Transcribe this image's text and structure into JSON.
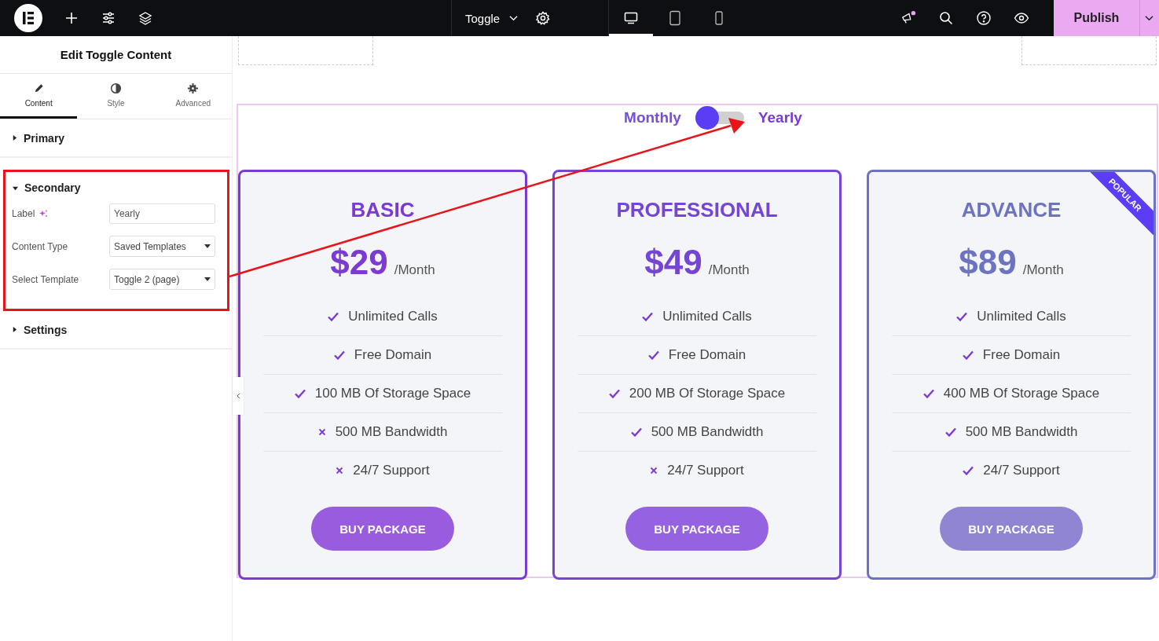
{
  "topbar": {
    "document": "Toggle",
    "devices": [
      {
        "kind": "desktop",
        "selected": true
      },
      {
        "kind": "tablet",
        "selected": false
      },
      {
        "kind": "mobile",
        "selected": false
      }
    ],
    "notification": true,
    "publish": "Publish"
  },
  "panel": {
    "title": "Edit Toggle Content",
    "tabs": [
      {
        "label": "Content",
        "kind": "pencil",
        "selected": true
      },
      {
        "label": "Style",
        "kind": "contrast",
        "selected": false
      },
      {
        "label": "Advanced",
        "kind": "gear",
        "selected": false
      }
    ],
    "sections": [
      {
        "title": "Primary",
        "expanded": false,
        "highlighted": false
      },
      {
        "title": "Secondary",
        "expanded": true,
        "highlighted": true,
        "fields": [
          {
            "label": "Label",
            "kind": "text",
            "ai": true,
            "value": "Yearly"
          },
          {
            "label": "Content Type",
            "kind": "select",
            "ai": false,
            "value": "Saved Templates"
          },
          {
            "label": "Select Template",
            "kind": "select",
            "ai": false,
            "value": "Toggle 2 (page)"
          }
        ]
      },
      {
        "title": "Settings",
        "expanded": false,
        "highlighted": false
      }
    ]
  },
  "toggle": {
    "left": "Monthly",
    "right": "Yearly",
    "on": false
  },
  "plans": [
    {
      "name": "BASIC",
      "price": "$29",
      "period": "/Month",
      "color": "#7b3bd3",
      "features": [
        {
          "text": "Unlimited Calls",
          "kind": "check"
        },
        {
          "text": "Free Domain",
          "kind": "check"
        },
        {
          "text": "100 MB Of Storage Space",
          "kind": "check"
        },
        {
          "text": "500 MB Bandwidth",
          "kind": "cross"
        },
        {
          "text": "24/7 Support",
          "kind": "cross"
        }
      ],
      "button": "BUY PACKAGE"
    },
    {
      "name": "PROFESSIONAL",
      "price": "$49",
      "period": "/Month",
      "color": "#7545d6",
      "features": [
        {
          "text": "Unlimited Calls",
          "kind": "check"
        },
        {
          "text": "Free Domain",
          "kind": "check"
        },
        {
          "text": "200 MB Of Storage Space",
          "kind": "check"
        },
        {
          "text": "500 MB Bandwidth",
          "kind": "check"
        },
        {
          "text": "24/7 Support",
          "kind": "cross"
        }
      ],
      "button": "BUY PACKAGE"
    },
    {
      "name": "ADVANCE",
      "price": "$89",
      "period": "/Month",
      "color": "#6c74c2",
      "ribbon": "POPULAR",
      "features": [
        {
          "text": "Unlimited Calls",
          "kind": "check"
        },
        {
          "text": "Free Domain",
          "kind": "check"
        },
        {
          "text": "400 MB Of Storage Space",
          "kind": "check"
        },
        {
          "text": "500 MB Bandwidth",
          "kind": "check"
        },
        {
          "text": "24/7 Support",
          "kind": "check"
        }
      ],
      "button": "BUY PACKAGE"
    }
  ]
}
